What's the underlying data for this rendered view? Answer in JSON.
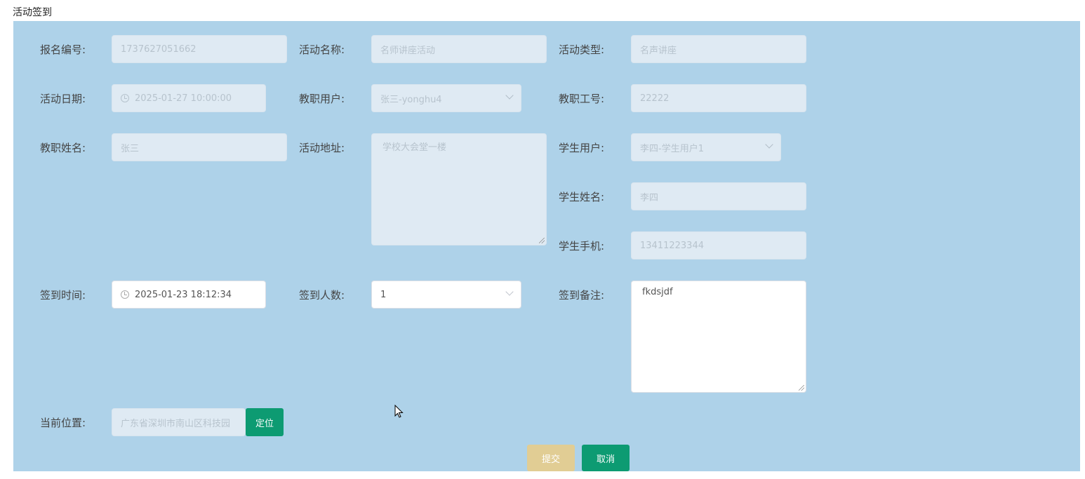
{
  "page": {
    "title": "活动签到"
  },
  "form": {
    "baoming_bianhao": {
      "label": "报名编号:",
      "value": "1737627051662"
    },
    "huodong_mingcheng": {
      "label": "活动名称:",
      "value": "名师讲座活动"
    },
    "huodong_leixing": {
      "label": "活动类型:",
      "value": "名声讲座"
    },
    "huodong_riqi": {
      "label": "活动日期:",
      "value": "2025-01-27 10:00:00"
    },
    "jiaozhi_yonghu": {
      "label": "教职用户:",
      "value": "张三-yonghu4"
    },
    "jiaozhi_gonghao": {
      "label": "教职工号:",
      "value": "22222"
    },
    "jiaozhi_xingming": {
      "label": "教职姓名:",
      "value": "张三"
    },
    "huodong_dizhi": {
      "label": "活动地址:",
      "value": "学校大会堂一楼"
    },
    "xuesheng_yonghu": {
      "label": "学生用户:",
      "value": "李四-学生用户1"
    },
    "xuesheng_xingming": {
      "label": "学生姓名:",
      "value": "李四"
    },
    "xuesheng_shouji": {
      "label": "学生手机:",
      "value": "13411223344"
    },
    "qiandao_shijian": {
      "label": "签到时间:",
      "value": "2025-01-23 18:12:34"
    },
    "qiandao_renshu": {
      "label": "签到人数:",
      "value": "1"
    },
    "qiandao_beizhu": {
      "label": "签到备注:",
      "value": "fkdsjdf"
    },
    "dangqian_weizhi": {
      "label": "当前位置:",
      "value": "广东省深圳市南山区科技园",
      "locate_button": "定位"
    }
  },
  "actions": {
    "submit": "提交",
    "cancel": "取消"
  },
  "colors": {
    "panel_bg": "#aed2e9",
    "primary_button": "#0d9b72",
    "submit_button": "#e1cd94"
  }
}
